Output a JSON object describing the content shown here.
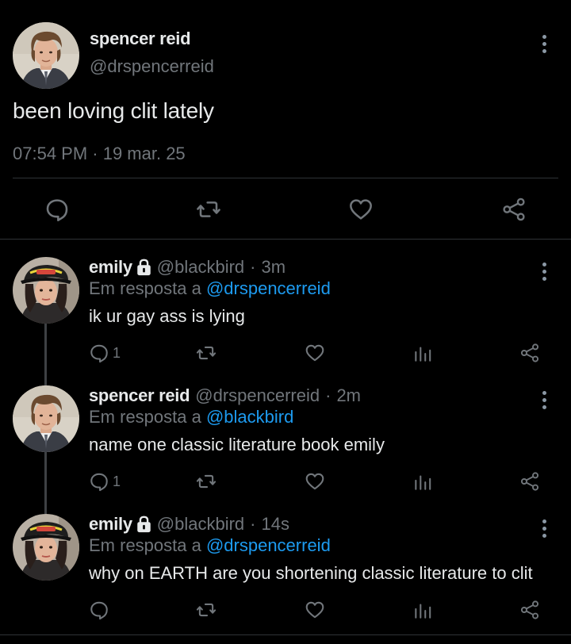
{
  "main_tweet": {
    "author_name": "spencer reid",
    "author_handle": "@drspencerreid",
    "text": "been loving clit lately",
    "timestamp": "07:54 PM · 19 mar. 25",
    "actions": [
      "reply-icon",
      "retweet-icon",
      "like-icon",
      "share-icon"
    ]
  },
  "replies": [
    {
      "name": "emily",
      "locked": true,
      "handle": "@blackbird",
      "separator": "·",
      "time": "3m",
      "replying_prefix": "Em resposta a ",
      "replying_to": "@drspencerreid",
      "text": "ik ur gay ass is lying",
      "reply_count": "1"
    },
    {
      "name": "spencer reid",
      "locked": false,
      "handle": "@drspencerreid",
      "separator": "·",
      "time": "2m",
      "replying_prefix": "Em resposta a ",
      "replying_to": "@blackbird",
      "text": "name one classic literature book emily",
      "reply_count": "1"
    },
    {
      "name": "emily",
      "locked": true,
      "handle": "@blackbird",
      "separator": "·",
      "time": "14s",
      "replying_prefix": "Em resposta a ",
      "replying_to": "@drspencerreid",
      "text": "why on EARTH are you shortening classic literature to clit",
      "reply_count": ""
    }
  ],
  "colors": {
    "background": "#000000",
    "text": "#e7e9ea",
    "muted": "#71767b",
    "mention": "#1d9bf0",
    "divider": "#2f3336"
  }
}
